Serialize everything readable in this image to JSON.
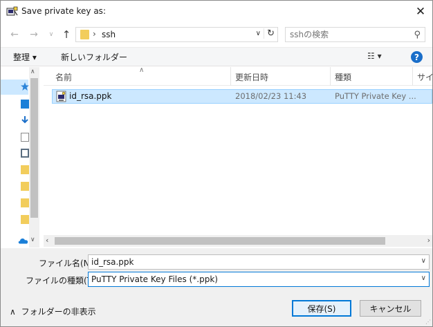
{
  "window": {
    "title": "Save private key as:"
  },
  "address": {
    "path_sep": "›",
    "folder": "ssh"
  },
  "search": {
    "placeholder": "sshの検索"
  },
  "toolbar": {
    "organize": "整理 ▾",
    "new_folder": "新しいフォルダー",
    "view": "☷ ▾",
    "help": "?"
  },
  "columns": {
    "name": "名前",
    "date": "更新日時",
    "type": "種類",
    "size": "サイズ"
  },
  "files": [
    {
      "name": "id_rsa.ppk",
      "date": "2018/02/23 11:43",
      "type": "PuTTY Private Key ..."
    }
  ],
  "form": {
    "filename_label": "ファイル名(N):",
    "filename_value": "id_rsa.ppk",
    "filetype_label": "ファイルの種類(T):",
    "filetype_value": "PuTTY Private Key Files (*.ppk)"
  },
  "footer": {
    "hide_folders": "フォルダーの非表示",
    "save_button": "保存(S)",
    "cancel_button": "キャンセル"
  },
  "colors": {
    "selection": "#cce8ff",
    "accent": "#0078d7",
    "folder": "#f2cd5c"
  }
}
